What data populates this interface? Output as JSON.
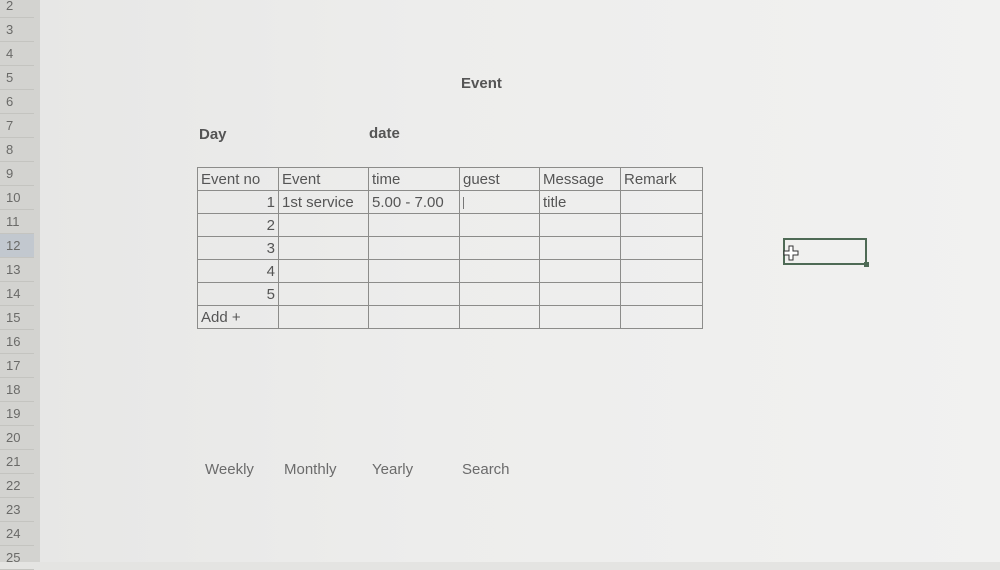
{
  "row_numbers": [
    "2",
    "3",
    "4",
    "5",
    "6",
    "7",
    "8",
    "9",
    "10",
    "11",
    "12",
    "13",
    "14",
    "15",
    "16",
    "17",
    "18",
    "19",
    "20",
    "21",
    "22",
    "23",
    "24",
    "25"
  ],
  "title": "Event",
  "labels": {
    "day": "Day",
    "date": "date"
  },
  "table": {
    "headers": [
      "Event no",
      "Event",
      "time",
      "guest",
      "Message",
      "Remark"
    ],
    "rows": [
      [
        "1",
        "1st service",
        "5.00 - 7.00",
        "",
        "title",
        ""
      ],
      [
        "2",
        "",
        "",
        "",
        "",
        ""
      ],
      [
        "3",
        "",
        "",
        "",
        "",
        ""
      ],
      [
        "4",
        "",
        "",
        "",
        "",
        ""
      ],
      [
        "5",
        "",
        "",
        "",
        "",
        ""
      ]
    ],
    "add_label": "Add +"
  },
  "nav": {
    "weekly": "Weekly",
    "monthly": "Monthly",
    "yearly": "Yearly",
    "search": "Search"
  },
  "colors": {
    "grid": "#8c8c8a",
    "selection": "#4e6a55"
  },
  "icons": {
    "cursor": "cell-select-cross-icon"
  }
}
